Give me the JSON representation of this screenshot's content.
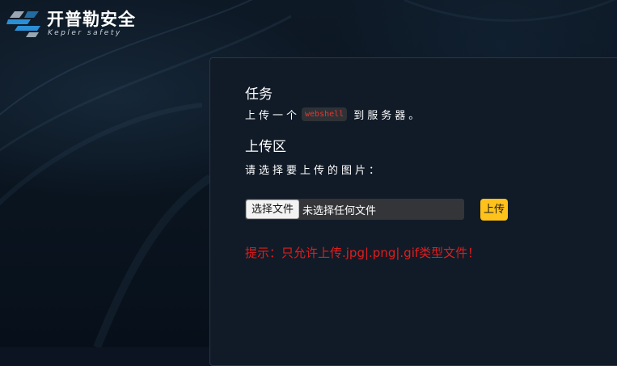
{
  "brand": {
    "title": "开普勒安全",
    "subtitle": "Kepler safety"
  },
  "task": {
    "heading": "任务",
    "text_before": "上传一个",
    "code": "webshell",
    "text_after": "到服务器。"
  },
  "upload": {
    "heading": "上传区",
    "hint": "请选择要上传的图片：",
    "choose_button": "选择文件",
    "file_status": "未选择任何文件",
    "submit_button": "上传",
    "tip": "提示：只允许上传.jpg|.png|.gif类型文件！"
  },
  "colors": {
    "accent_button": "#ffc21a",
    "tip_text": "#e11d1d",
    "code_text": "#e8342f",
    "logo_blue": "#2b8fd6"
  }
}
